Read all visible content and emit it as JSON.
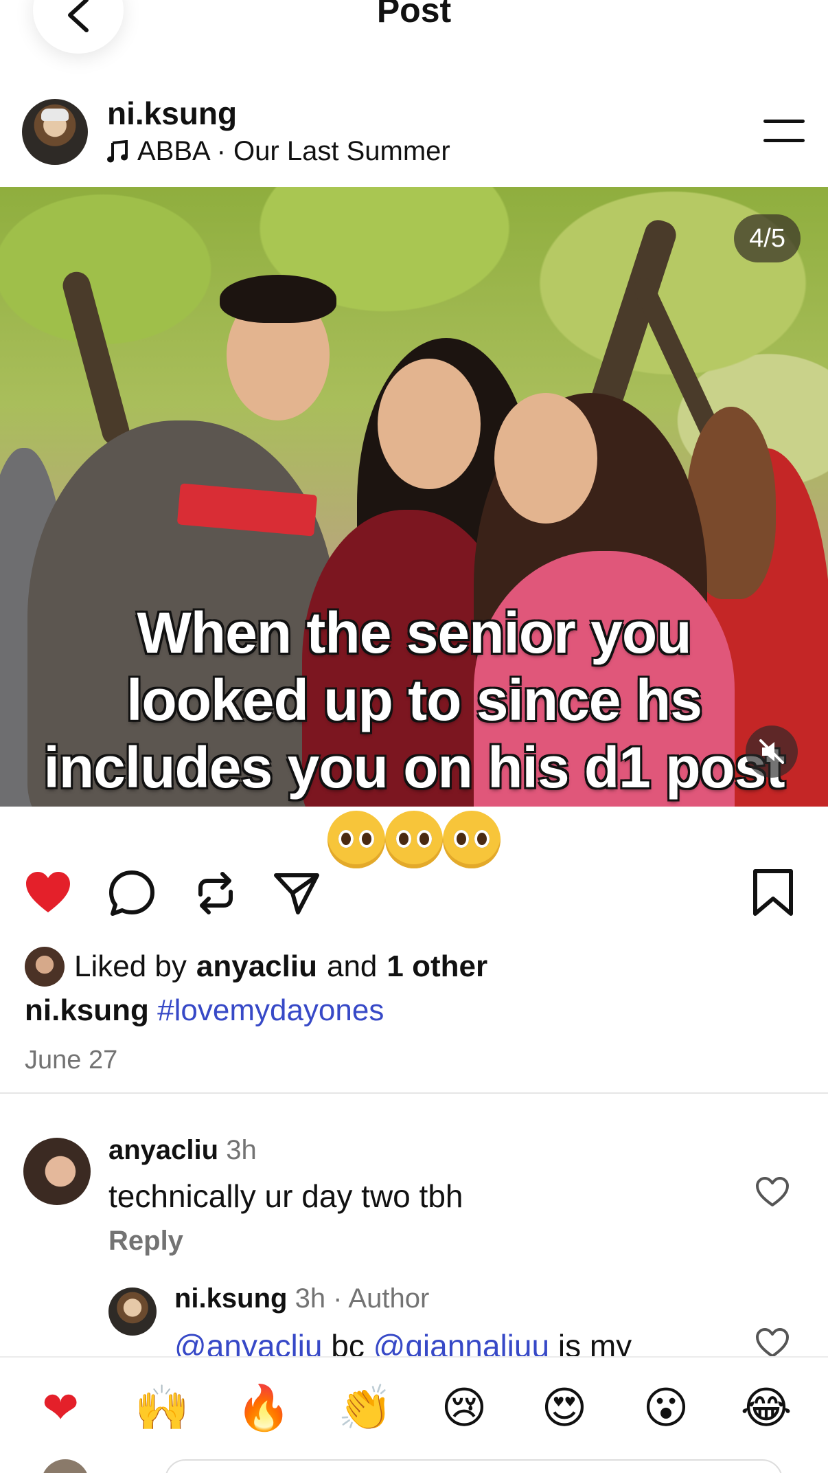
{
  "header": {
    "title": "Post"
  },
  "author": {
    "username": "ni.ksung",
    "music": "ABBA · Our Last Summer"
  },
  "media": {
    "counter": "4/5",
    "caption_lines": [
      "When the senior you",
      "looked up to since hs",
      "includes you on his d1 post"
    ],
    "emoji_count": 3
  },
  "actions": {
    "liked": true,
    "icons": [
      "heart-icon",
      "comment-icon",
      "repost-icon",
      "share-icon",
      "bookmark-icon"
    ]
  },
  "likes": {
    "prefix": "Liked by",
    "user": "anyacliu",
    "and": "and",
    "others": "1 other"
  },
  "caption": {
    "username": "ni.ksung",
    "hashtag": "#lovemydayones"
  },
  "date": "June 27",
  "comments": [
    {
      "username": "anyacliu",
      "time": "3h",
      "text": "technically ur day two tbh",
      "reply_label": "Reply"
    },
    {
      "username": "ni.ksung",
      "time": "3h · Author",
      "mention1": "@anyacliu",
      "mid": " bc ",
      "mention2": "@giannaliuu",
      "tail": " is my"
    }
  ],
  "reactions": [
    "❤",
    "🙌",
    "🔥",
    "👏",
    "😢",
    "😍",
    "😮",
    "😂"
  ],
  "colors": {
    "like_red": "#e4202a",
    "link_blue": "#3749c7",
    "muted_gray": "#737373"
  }
}
